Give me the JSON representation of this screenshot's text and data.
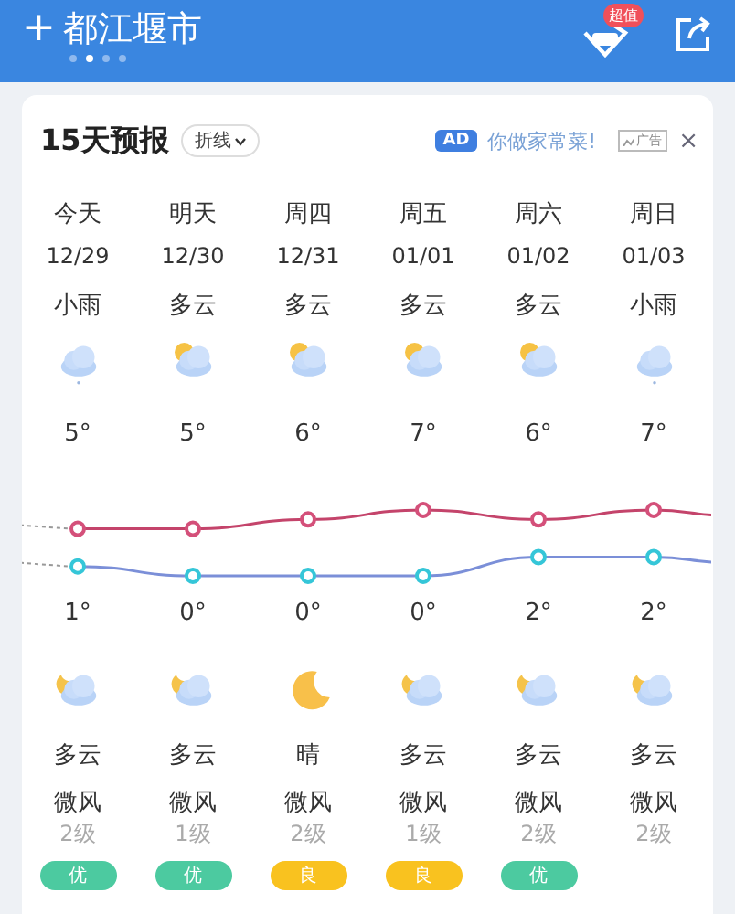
{
  "header": {
    "add": "+",
    "city": "都江堰市",
    "pages": [
      {
        "selected": false
      },
      {
        "selected": true
      },
      {
        "selected": false
      },
      {
        "selected": false
      }
    ],
    "vip_badge": "超值"
  },
  "forecast": {
    "title": "15天预报",
    "mode": "折线",
    "ad": {
      "tag": "AD",
      "text": "你做家常菜!",
      "label": "广告",
      "close": "×"
    },
    "days": [
      {
        "day": "今天",
        "date": "12/29",
        "cond": "小雨",
        "day_icon": {
          "kind": "rain"
        },
        "high": "5°",
        "low": "1°",
        "night_icon": {
          "kind": "cloud-moon"
        },
        "night_cond": "多云",
        "wind": "微风",
        "wind_level": "2级",
        "aqi": {
          "text": "优",
          "color": "#4ccaa0"
        }
      },
      {
        "day": "明天",
        "date": "12/30",
        "cond": "多云",
        "day_icon": {
          "kind": "cloud-sun"
        },
        "high": "5°",
        "low": "0°",
        "night_icon": {
          "kind": "cloud-moon"
        },
        "night_cond": "多云",
        "wind": "微风",
        "wind_level": "1级",
        "aqi": {
          "text": "优",
          "color": "#4ccaa0"
        }
      },
      {
        "day": "周四",
        "date": "12/31",
        "cond": "多云",
        "day_icon": {
          "kind": "cloud-sun"
        },
        "high": "6°",
        "low": "0°",
        "night_icon": {
          "kind": "moon"
        },
        "night_cond": "晴",
        "wind": "微风",
        "wind_level": "2级",
        "aqi": {
          "text": "良",
          "color": "#f9c21f"
        }
      },
      {
        "day": "周五",
        "date": "01/01",
        "cond": "多云",
        "day_icon": {
          "kind": "cloud-sun"
        },
        "high": "7°",
        "low": "0°",
        "night_icon": {
          "kind": "cloud-moon"
        },
        "night_cond": "多云",
        "wind": "微风",
        "wind_level": "1级",
        "aqi": {
          "text": "良",
          "color": "#f9c21f"
        }
      },
      {
        "day": "周六",
        "date": "01/02",
        "cond": "多云",
        "day_icon": {
          "kind": "cloud-sun"
        },
        "high": "6°",
        "low": "2°",
        "night_icon": {
          "kind": "cloud-moon"
        },
        "night_cond": "多云",
        "wind": "微风",
        "wind_level": "2级",
        "aqi": {
          "text": "优",
          "color": "#4ccaa0"
        }
      },
      {
        "day": "周日",
        "date": "01/03",
        "cond": "小雨",
        "day_icon": {
          "kind": "rain"
        },
        "high": "7°",
        "low": "2°",
        "night_icon": {
          "kind": "cloud-moon"
        },
        "night_cond": "多云",
        "wind": "微风",
        "wind_level": "2级"
      }
    ]
  }
}
